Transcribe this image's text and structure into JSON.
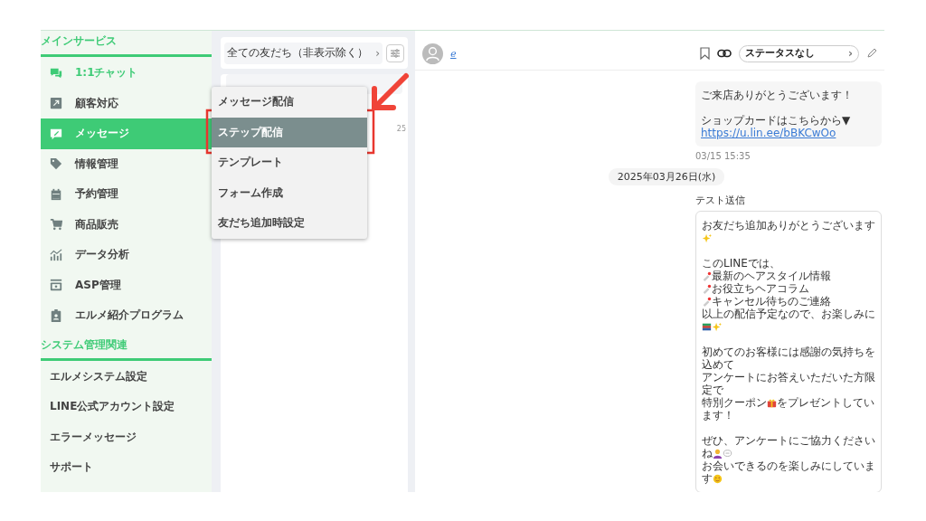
{
  "sidebar": {
    "sections": [
      {
        "title": "メインサービス",
        "items": [
          {
            "label": "1:1チャット",
            "highlighted": true,
            "selected": false
          },
          {
            "label": "顧客対応",
            "highlighted": false,
            "selected": false
          },
          {
            "label": "メッセージ",
            "highlighted": false,
            "selected": true
          },
          {
            "label": "情報管理",
            "highlighted": false,
            "selected": false
          },
          {
            "label": "予約管理",
            "highlighted": false,
            "selected": false
          },
          {
            "label": "商品販売",
            "highlighted": false,
            "selected": false
          },
          {
            "label": "データ分析",
            "highlighted": false,
            "selected": false
          },
          {
            "label": "ASP管理",
            "highlighted": false,
            "selected": false
          },
          {
            "label": "エルメ紹介プログラム",
            "highlighted": false,
            "selected": false
          }
        ]
      },
      {
        "title": "システム管理関連",
        "items": [
          {
            "label": "エルメシステム設定",
            "highlighted": false,
            "selected": false
          },
          {
            "label": "LINE公式アカウント設定",
            "highlighted": false,
            "selected": false
          },
          {
            "label": "エラーメッセージ",
            "highlighted": false,
            "selected": false
          },
          {
            "label": "サポート",
            "highlighted": false,
            "selected": false
          }
        ]
      }
    ]
  },
  "friends": {
    "filter": "全ての友だち（非表示除く）",
    "filter_chevron": "›",
    "row_time": "25"
  },
  "menu": {
    "items": [
      {
        "label": "メッセージ配信",
        "selected": false
      },
      {
        "label": "ステップ配信",
        "selected": true
      },
      {
        "label": "テンプレート",
        "selected": false
      },
      {
        "label": "フォーム作成",
        "selected": false
      },
      {
        "label": "友だち追加時設定",
        "selected": false
      }
    ]
  },
  "chat": {
    "name": "ℯ",
    "status": "ステータスなし",
    "status_chevron": "›",
    "messages": [
      {
        "kind": "bubble",
        "paragraphs": [
          [
            [
              {
                "kind": "text",
                "text": "ご来店ありがとうございます！"
              }
            ]
          ],
          [
            [
              {
                "kind": "text",
                "text": "ショップカードはこちらから▼"
              }
            ],
            [
              {
                "kind": "link",
                "text": "https://u.lin.ee/bBKCwOo"
              }
            ]
          ]
        ],
        "time": "03/15 15:35"
      },
      {
        "kind": "date",
        "text": "2025年03月26日(水)"
      },
      {
        "kind": "bubble",
        "label": "テスト送信",
        "paragraphs": [
          [
            [
              {
                "kind": "text",
                "text": "お友だち追加ありがとうございます"
              }
            ],
            [
              {
                "kind": "sparkle"
              }
            ]
          ],
          [
            [
              {
                "kind": "text",
                "text": "このLINEでは、"
              }
            ],
            [
              {
                "kind": "pin"
              },
              {
                "kind": "text",
                "text": "最新のヘアスタイル情報"
              }
            ],
            [
              {
                "kind": "pin"
              },
              {
                "kind": "text",
                "text": "お役立ちヘアコラム"
              }
            ],
            [
              {
                "kind": "pin"
              },
              {
                "kind": "text",
                "text": "キャンセル待ちのご連絡"
              }
            ],
            [
              {
                "kind": "text",
                "text": "以上の配信予定なので、お楽しみに"
              }
            ],
            [
              {
                "kind": "books"
              },
              {
                "kind": "sparkle"
              }
            ]
          ],
          [
            [
              {
                "kind": "text",
                "text": "初めてのお客様には感謝の気持ちを"
              }
            ],
            [
              {
                "kind": "text",
                "text": "込めて"
              }
            ],
            [
              {
                "kind": "text",
                "text": "アンケートにお答えいただいた方限"
              }
            ],
            [
              {
                "kind": "text",
                "text": "定で"
              }
            ],
            [
              {
                "kind": "text",
                "text": "特別クーポン"
              },
              {
                "kind": "gift"
              },
              {
                "kind": "text",
                "text": "をプレゼントしてい"
              }
            ],
            [
              {
                "kind": "text",
                "text": "ます！"
              }
            ]
          ],
          [
            [
              {
                "kind": "text",
                "text": "ぜひ、アンケートにご協力ください"
              }
            ],
            [
              {
                "kind": "text",
                "text": "ね"
              },
              {
                "kind": "person"
              },
              {
                "kind": "speech"
              }
            ],
            [
              {
                "kind": "text",
                "text": "お会いできるのを楽しみにしていま"
              }
            ],
            [
              {
                "kind": "text",
                "text": "す"
              },
              {
                "kind": "smile"
              }
            ]
          ]
        ]
      }
    ]
  }
}
